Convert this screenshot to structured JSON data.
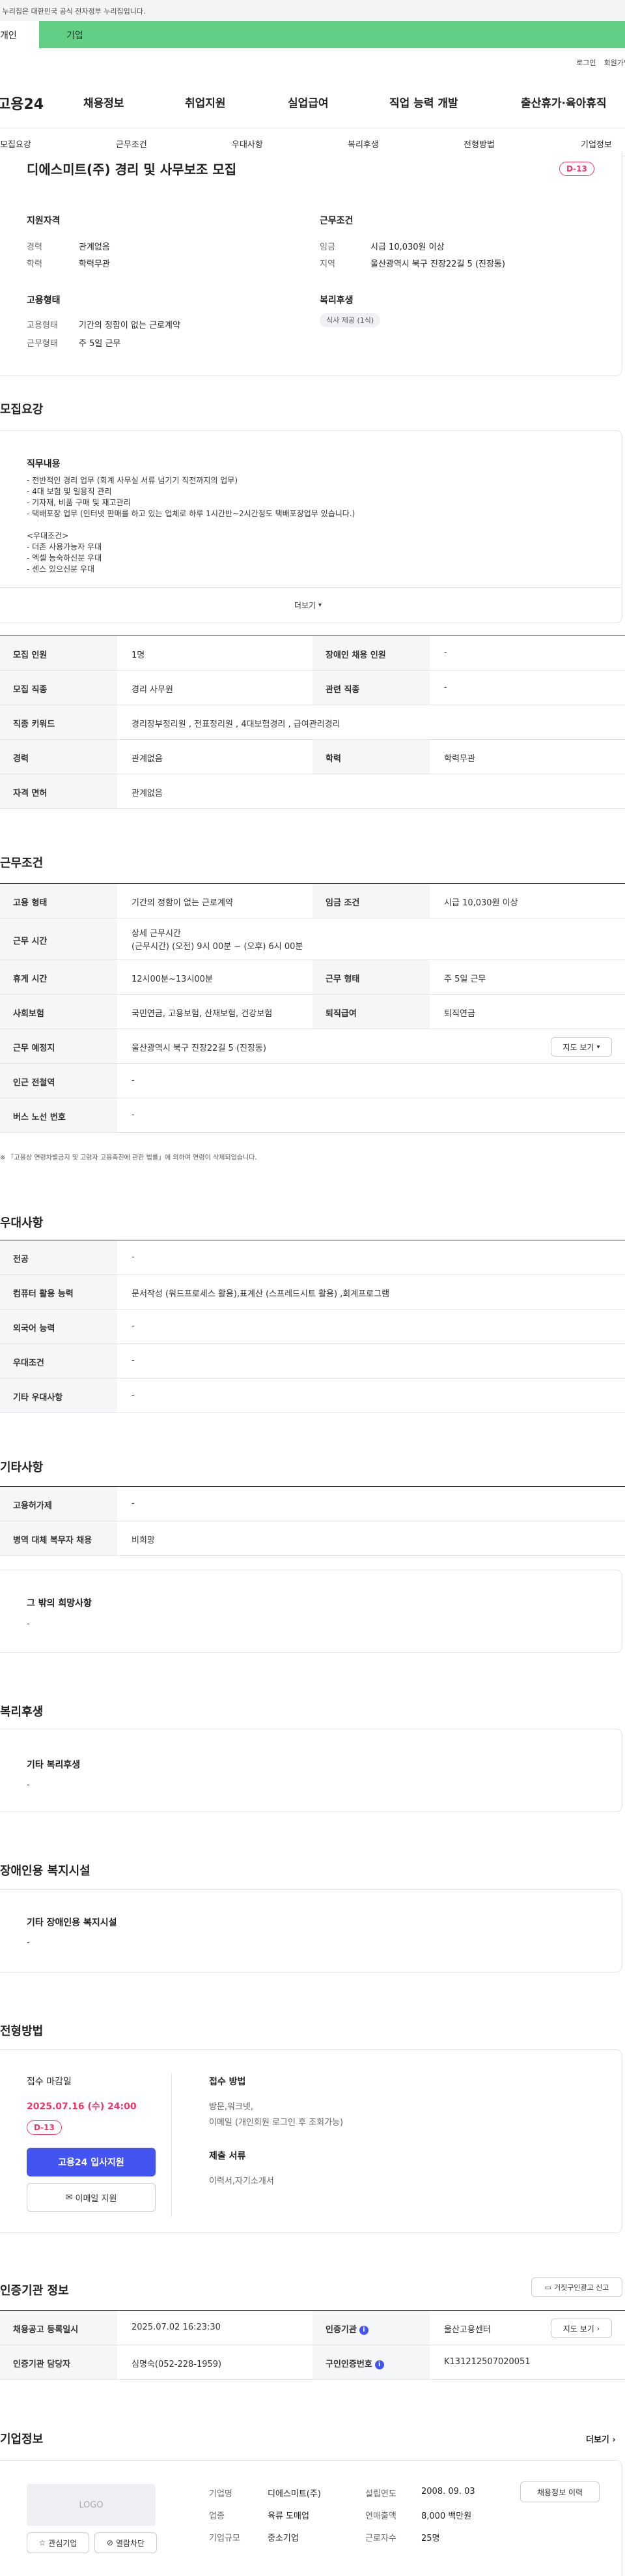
{
  "gov_banner": "이 누리집은 대한민국 공식 전자정부 누리집입니다.",
  "user_tabs": [
    "개인",
    "기업"
  ],
  "util_links": [
    "로그인",
    "회원가입"
  ],
  "site_logo": "고용24",
  "gnb": [
    "채용정보",
    "취업지원",
    "실업급여",
    "직업 능력 개발",
    "출산휴가·육아휴직"
  ],
  "lnb": [
    "모집요강",
    "근무조건",
    "우대사항",
    "복리후생",
    "전형방법",
    "기업정보"
  ],
  "summary": {
    "title": "디에스미트(주) 경리 및 사무보조 모집",
    "dday": "D-13",
    "qual_title": "지원자격",
    "career_label": "경력",
    "career_value": "관계없음",
    "edu_label": "학력",
    "edu_value": "학력무관",
    "cond_title": "근무조건",
    "wage_label": "임금",
    "wage_value": "시급 10,030원 이상",
    "region_label": "지역",
    "region_value": "울산광역시 북구 진장22길 5 (진장동)",
    "emp_title": "고용형태",
    "emptype_label": "고용형태",
    "emptype_value": "기간의 정함이 없는 근로계약",
    "workform_label": "근무형태",
    "workform_value": "주 5일 근무",
    "welfare_title": "복리후생",
    "welfare_pill": "식사 제공 (1식)"
  },
  "recruit": {
    "section_title": "모집요강",
    "duty_title": "직무내용",
    "duty_lines": [
      "- 전반적인 경리 업무 (회계 사무실 서류 넘기기 직전까지의 업무)",
      "- 4대 보험 및 일용직 관리",
      "- 기자재, 비품 구매 및 재고관리",
      "- 택배포장 업무 (인터넷 판매를 하고 있는 업체로 하루 1시간반~2시간정도 택배포장업무 있습니다.)",
      "",
      "<우대조건>",
      "- 더존 사용가능자 우대",
      "- 엑셀 능숙하신분 우대",
      "- 센스 있으신분 우대"
    ],
    "more_label": "더보기",
    "rows": [
      {
        "h1": "모집 인원",
        "v1": "1명",
        "h2": "장애인 채용 인원",
        "v2": "-"
      },
      {
        "h1": "모집 직종",
        "v1": "경리 사무원",
        "h2": "관련 직종",
        "v2": "-"
      },
      {
        "h1": "직종 키워드",
        "v1": "경리장부정리원 , 전표정리원 , 4대보험경리 , 급여관리경리"
      },
      {
        "h1": "경력",
        "v1": "관계없음",
        "h2": "학력",
        "v2": "학력무관"
      },
      {
        "h1": "자격 면허",
        "v1": "관계없음"
      }
    ]
  },
  "work": {
    "section_title": "근무조건",
    "emptype_h": "고용 형태",
    "emptype_v": "기간의 정함이 없는 근로계약",
    "wage_h": "임금 조건",
    "wage_v": "시급 10,030원 이상",
    "time_h": "근무 시간",
    "time_title": "상세 근무시간",
    "time_v": "(근무시간) (오전) 9시 00분 ~ (오후) 6시 00분",
    "rest_h": "휴게 시간",
    "rest_v": "12시00분~13시00분",
    "form_h": "근무 형태",
    "form_v": "주 5일 근무",
    "ins_h": "사회보험",
    "ins_v": "국민연금, 고용보험, 산재보험, 건강보험",
    "sev_h": "퇴직급여",
    "sev_v": "퇴직연금",
    "place_h": "근무 예정지",
    "place_v": "울산광역시 북구 진장22길 5 (진장동)",
    "map_btn": "지도 보기",
    "subway_h": "인근 전철역",
    "subway_v": "-",
    "bus_h": "버스 노선 번호",
    "bus_v": "-",
    "note": "※ 「고용상 연령차별금지 및 고령자 고용촉진에 관한 법률」에 의하여 연령이 삭제되었습니다."
  },
  "pref": {
    "section_title": "우대사항",
    "rows": [
      [
        "전공",
        "-"
      ],
      [
        "컴퓨터 활용 능력",
        "문서작성 (워드프로세스 활용),표계산 (스프레드시트 활용) ,회계프로그램"
      ],
      [
        "외국어 능력",
        "-"
      ],
      [
        "우대조건",
        "-"
      ],
      [
        "기타 우대사항",
        "-"
      ]
    ]
  },
  "etc": {
    "section_title": "기타사항",
    "rows": [
      [
        "고용허가제",
        "-"
      ],
      [
        "병역 대체 복무자 채용",
        "비희망"
      ]
    ],
    "hope_title": "그 밖의 희망사항",
    "hope_v": "-"
  },
  "welfare": {
    "section_title": "복리후생",
    "box_title": "기타 복리후생",
    "box_v": "-"
  },
  "disab": {
    "section_title": "장애인용 복지시설",
    "box_title": "기타 장애인용 복지시설",
    "box_v": "-"
  },
  "select": {
    "section_title": "전형방법",
    "deadline_title": "접수 마감일",
    "deadline_v": "2025.07.16 (수) 24:00",
    "dday": "D-13",
    "apply_btn": "고용24 입사지원",
    "email_btn": "이메일 지원",
    "method_title": "접수 방법",
    "method_v1": "방문,워크넷,",
    "method_v2": "이메일 (개인회원 로그인 후 조회가능)",
    "docs_title": "제출 서류",
    "docs_v": "이력서,자기소개서"
  },
  "cert": {
    "section_title": "인증기관 정보",
    "report_btn": "거짓구인광고 신고",
    "reg_h": "채용공고 등록일시",
    "reg_v": "2025.07.02 16:23:30",
    "org_h": "인증기관",
    "org_v": "울산고용센터",
    "map_btn": "지도 보기",
    "mgr_h": "인증기관 담당자",
    "mgr_v": "심명숙(052-228-1959)",
    "no_h": "구인인증번호",
    "no_v": "K131212507020051"
  },
  "company": {
    "section_title": "기업정보",
    "more": "더보기",
    "logo_text": "LOGO",
    "name_h": "기업명",
    "name_v": "디에스미트(주)",
    "year_h": "설립연도",
    "year_v": "2008. 09. 03",
    "ind_h": "업종",
    "ind_v": "육류 도매업",
    "sales_h": "연매출액",
    "sales_v": "8,000 백만원",
    "size_h": "기업규모",
    "size_v": "중소기업",
    "emp_h": "근로자수",
    "emp_v": "25명",
    "history_btn": "채용정보 이력",
    "fav_btn": "관심기업",
    "block_btn": "열람차단"
  }
}
